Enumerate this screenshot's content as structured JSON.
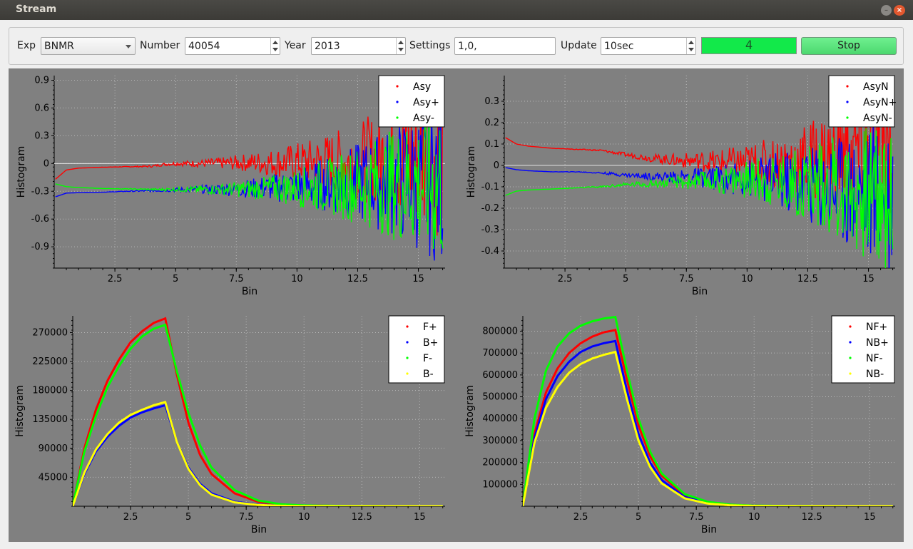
{
  "window": {
    "title": "Stream"
  },
  "toolbar": {
    "exp_label": "Exp",
    "exp_value": "BNMR",
    "number_label": "Number",
    "number_value": "40054",
    "year_label": "Year",
    "year_value": "2013",
    "settings_label": "Settings",
    "settings_value": "1,0,",
    "update_label": "Update",
    "update_value": "10sec",
    "counter": "4",
    "stop_label": "Stop"
  },
  "colors": {
    "red": "#ff0000",
    "blue": "#0000ff",
    "green": "#00ff00",
    "yellow": "#ffff00",
    "plot_bg": "#808080"
  },
  "plots": [
    {
      "ylabel": "Histogram",
      "xlabel": "Bin",
      "yticks": [
        "0.9",
        "0.6",
        "0.3",
        "0",
        "-0.3",
        "-0.6",
        "-0.9"
      ],
      "xticks": [
        "2.5",
        "5",
        "7.5",
        "10",
        "12.5",
        "15"
      ],
      "legend": [
        "Asy",
        "Asy+",
        "Asy-"
      ]
    },
    {
      "ylabel": "Histogram",
      "xlabel": "Bin",
      "yticks": [
        "0.3",
        "0.2",
        "0.1",
        "0",
        "-0.1",
        "-0.2",
        "-0.3",
        "-0.4"
      ],
      "xticks": [
        "2.5",
        "5",
        "7.5",
        "10",
        "12.5",
        "15"
      ],
      "legend": [
        "AsyN",
        "AsyN+",
        "AsyN-"
      ]
    },
    {
      "ylabel": "Histogram",
      "xlabel": "Bin",
      "yticks": [
        "270000",
        "225000",
        "180000",
        "135000",
        "90000",
        "45000"
      ],
      "xticks": [
        "2.5",
        "5",
        "7.5",
        "10",
        "12.5",
        "15"
      ],
      "legend": [
        "F+",
        "B+",
        "F-",
        "B-"
      ]
    },
    {
      "ylabel": "Histogram",
      "xlabel": "Bin",
      "yticks": [
        "800000",
        "700000",
        "600000",
        "500000",
        "400000",
        "300000",
        "200000",
        "100000"
      ],
      "xticks": [
        "2.5",
        "5",
        "7.5",
        "10",
        "12.5",
        "15"
      ],
      "legend": [
        "NF+",
        "NB+",
        "NF-",
        "NB-"
      ]
    }
  ],
  "chart_data": [
    {
      "type": "scatter",
      "xlim": [
        0,
        16.1
      ],
      "ylim": [
        -1.13,
        0.95
      ],
      "grid": true,
      "legend_position": "top-right",
      "series": [
        {
          "name": "Asy",
          "color": "#ff0000",
          "x": [
            0.05,
            0.5,
            1,
            2,
            3,
            4,
            4.5,
            5,
            6,
            7,
            8,
            9,
            10,
            11,
            12,
            13,
            14,
            15,
            16
          ],
          "y": [
            -0.17,
            -0.07,
            -0.05,
            -0.04,
            -0.035,
            -0.03,
            -0.01,
            0,
            0,
            0.005,
            0.01,
            0.01,
            0.02,
            0.02,
            0.03,
            0.04,
            0.06,
            0.07,
            0.09
          ]
        },
        {
          "name": "Asy+",
          "color": "#0000ff",
          "x": [
            0.05,
            0.5,
            1,
            2,
            3,
            4,
            5,
            6,
            7,
            8,
            9,
            10,
            11,
            12,
            13,
            14,
            15,
            16
          ],
          "y": [
            -0.36,
            -0.32,
            -0.315,
            -0.31,
            -0.3,
            -0.295,
            -0.285,
            -0.28,
            -0.28,
            -0.27,
            -0.26,
            -0.25,
            -0.23,
            -0.21,
            -0.2,
            -0.19,
            -0.19,
            -0.18
          ]
        },
        {
          "name": "Asy-",
          "color": "#00ff00",
          "x": [
            0.05,
            0.5,
            1,
            2,
            3,
            4,
            5,
            6,
            7,
            8,
            9,
            10,
            11,
            12,
            13,
            14,
            15,
            16
          ],
          "y": [
            -0.22,
            -0.25,
            -0.26,
            -0.27,
            -0.275,
            -0.28,
            -0.28,
            -0.28,
            -0.28,
            -0.275,
            -0.27,
            -0.26,
            -0.25,
            -0.24,
            -0.23,
            -0.22,
            -0.21,
            -0.2
          ]
        }
      ]
    },
    {
      "type": "scatter",
      "xlim": [
        0,
        16.1
      ],
      "ylim": [
        -0.48,
        0.42
      ],
      "grid": true,
      "legend_position": "top-right",
      "series": [
        {
          "name": "AsyN",
          "color": "#ff0000",
          "x": [
            0.05,
            0.5,
            1,
            2,
            3,
            4,
            5,
            6,
            7,
            8,
            9,
            10,
            11,
            12,
            13,
            14,
            15,
            16
          ],
          "y": [
            0.13,
            0.1,
            0.09,
            0.08,
            0.075,
            0.07,
            0.05,
            0.035,
            0.025,
            0.02,
            0.015,
            0.01,
            0.01,
            0.02,
            0.03,
            0.05,
            0.07,
            0.1
          ]
        },
        {
          "name": "AsyN+",
          "color": "#0000ff",
          "x": [
            0.05,
            0.5,
            1,
            2,
            3,
            4,
            5,
            6,
            7,
            8,
            9,
            10,
            11,
            12,
            13,
            14,
            15,
            16
          ],
          "y": [
            -0.01,
            -0.02,
            -0.025,
            -0.03,
            -0.03,
            -0.035,
            -0.045,
            -0.05,
            -0.055,
            -0.055,
            -0.06,
            -0.06,
            -0.07,
            -0.08,
            -0.09,
            -0.1,
            -0.12,
            -0.14
          ]
        },
        {
          "name": "AsyN-",
          "color": "#00ff00",
          "x": [
            0.05,
            0.5,
            1,
            2,
            3,
            4,
            5,
            6,
            7,
            8,
            9,
            10,
            11,
            12,
            13,
            14,
            15,
            16
          ],
          "y": [
            -0.14,
            -0.12,
            -0.115,
            -0.11,
            -0.105,
            -0.1,
            -0.09,
            -0.085,
            -0.08,
            -0.075,
            -0.07,
            -0.065,
            -0.07,
            -0.08,
            -0.09,
            -0.11,
            -0.12,
            -0.14
          ]
        }
      ]
    },
    {
      "type": "scatter",
      "xlim": [
        0,
        16.1
      ],
      "ylim": [
        0,
        296000
      ],
      "grid": true,
      "legend_position": "top-right",
      "series": [
        {
          "name": "F+",
          "color": "#ff0000",
          "x": [
            0,
            0.5,
            1,
            1.5,
            2,
            2.5,
            3,
            3.5,
            4,
            4.5,
            5,
            5.5,
            6,
            7,
            8,
            9,
            10,
            12,
            14,
            16
          ],
          "y": [
            0,
            90000,
            150000,
            195000,
            228000,
            255000,
            272000,
            285000,
            292000,
            205000,
            130000,
            80000,
            50000,
            20000,
            7000,
            2500,
            1000,
            300,
            100,
            0
          ]
        },
        {
          "name": "B+",
          "color": "#0000ff",
          "x": [
            0,
            0.5,
            1,
            1.5,
            2,
            2.5,
            3,
            3.5,
            4,
            4.5,
            5,
            5.5,
            6,
            7,
            8,
            9,
            10,
            12,
            14,
            16
          ],
          "y": [
            0,
            50000,
            85000,
            108000,
            125000,
            138000,
            146000,
            152000,
            157000,
            100000,
            60000,
            35000,
            20000,
            7000,
            2500,
            800,
            300,
            100,
            0,
            0
          ]
        },
        {
          "name": "F-",
          "color": "#00ff00",
          "x": [
            0,
            0.5,
            1,
            1.5,
            2,
            2.5,
            3,
            3.5,
            4,
            4.5,
            5,
            5.5,
            6,
            7,
            8,
            9,
            10,
            12,
            14,
            16
          ],
          "y": [
            0,
            85000,
            140000,
            185000,
            218000,
            245000,
            264000,
            276000,
            282000,
            210000,
            145000,
            95000,
            60000,
            25000,
            9000,
            3000,
            1200,
            300,
            100,
            0
          ]
        },
        {
          "name": "B-",
          "color": "#ffff00",
          "x": [
            0,
            0.5,
            1,
            1.5,
            2,
            2.5,
            3,
            3.5,
            4,
            4.5,
            5,
            5.5,
            6,
            7,
            8,
            9,
            10,
            12,
            14,
            16
          ],
          "y": [
            0,
            52000,
            88000,
            112000,
            130000,
            142000,
            150000,
            157000,
            162000,
            100000,
            58000,
            33000,
            18000,
            6000,
            2000,
            700,
            300,
            100,
            0,
            0
          ]
        }
      ]
    },
    {
      "type": "scatter",
      "xlim": [
        0,
        16.1
      ],
      "ylim": [
        0,
        870000
      ],
      "grid": true,
      "legend_position": "top-right",
      "series": [
        {
          "name": "NF+",
          "color": "#ff0000",
          "x": [
            0,
            0.5,
            1,
            1.5,
            2,
            2.5,
            3,
            3.5,
            4,
            4.5,
            5,
            5.5,
            6,
            7,
            8,
            9,
            10,
            12,
            14,
            16
          ],
          "y": [
            0,
            330000,
            520000,
            630000,
            700000,
            745000,
            775000,
            795000,
            805000,
            580000,
            370000,
            230000,
            140000,
            50000,
            18000,
            6000,
            2000,
            500,
            100,
            0
          ]
        },
        {
          "name": "NB+",
          "color": "#0000ff",
          "x": [
            0,
            0.5,
            1,
            1.5,
            2,
            2.5,
            3,
            3.5,
            4,
            4.5,
            5,
            5.5,
            6,
            7,
            8,
            9,
            10,
            12,
            14,
            16
          ],
          "y": [
            0,
            310000,
            490000,
            595000,
            660000,
            705000,
            730000,
            745000,
            755000,
            530000,
            330000,
            200000,
            120000,
            42000,
            15000,
            5000,
            1800,
            400,
            100,
            0
          ]
        },
        {
          "name": "NF-",
          "color": "#00ff00",
          "x": [
            0,
            0.5,
            1,
            1.5,
            2,
            2.5,
            3,
            3.5,
            4,
            4.5,
            5,
            5.5,
            6,
            7,
            8,
            9,
            10,
            12,
            14,
            16
          ],
          "y": [
            0,
            400000,
            620000,
            730000,
            790000,
            825000,
            845000,
            858000,
            865000,
            620000,
            400000,
            250000,
            150000,
            55000,
            20000,
            7000,
            2500,
            600,
            100,
            0
          ]
        },
        {
          "name": "NB-",
          "color": "#ffff00",
          "x": [
            0,
            0.5,
            1,
            1.5,
            2,
            2.5,
            3,
            3.5,
            4,
            4.5,
            5,
            5.5,
            6,
            7,
            8,
            9,
            10,
            12,
            14,
            16
          ],
          "y": [
            0,
            290000,
            450000,
            545000,
            610000,
            650000,
            675000,
            692000,
            705000,
            490000,
            300000,
            180000,
            105000,
            36000,
            12000,
            4000,
            1500,
            400,
            100,
            0
          ]
        }
      ]
    }
  ]
}
